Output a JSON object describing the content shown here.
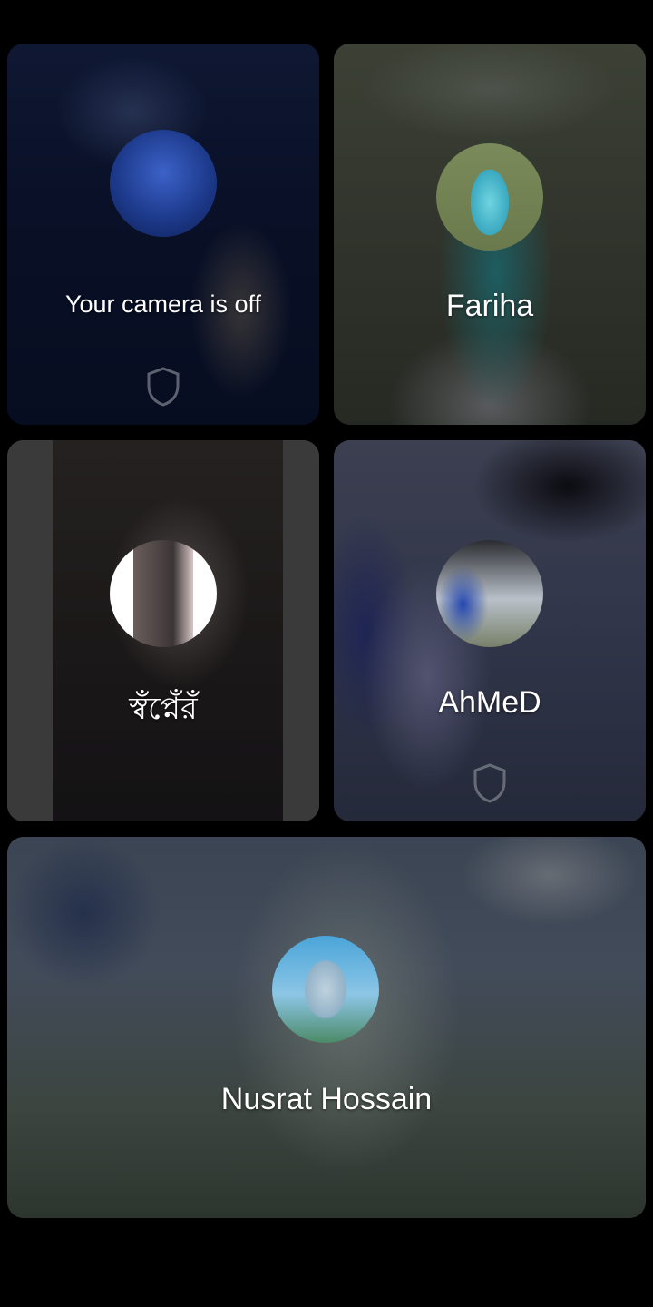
{
  "participants": [
    {
      "label": "Your camera is off",
      "avatar_icon": "self-avatar-photo",
      "shows_shield": true
    },
    {
      "label": "Fariha",
      "avatar_icon": "fariha-avatar-photo",
      "shows_shield": false
    },
    {
      "label": "স্বঁপ্নেঁরঁ",
      "avatar_icon": "swapner-avatar-photo",
      "shows_shield": false
    },
    {
      "label": "AhMeD",
      "avatar_icon": "ahmed-avatar-photo",
      "shows_shield": true
    },
    {
      "label": "Nusrat Hossain",
      "avatar_icon": "nusrat-avatar-photo",
      "shows_shield": false
    }
  ],
  "colors": {
    "screen_background": "#000000",
    "text": "#ffffff",
    "shield_outline": "rgba(255,255,255,0.35)"
  }
}
